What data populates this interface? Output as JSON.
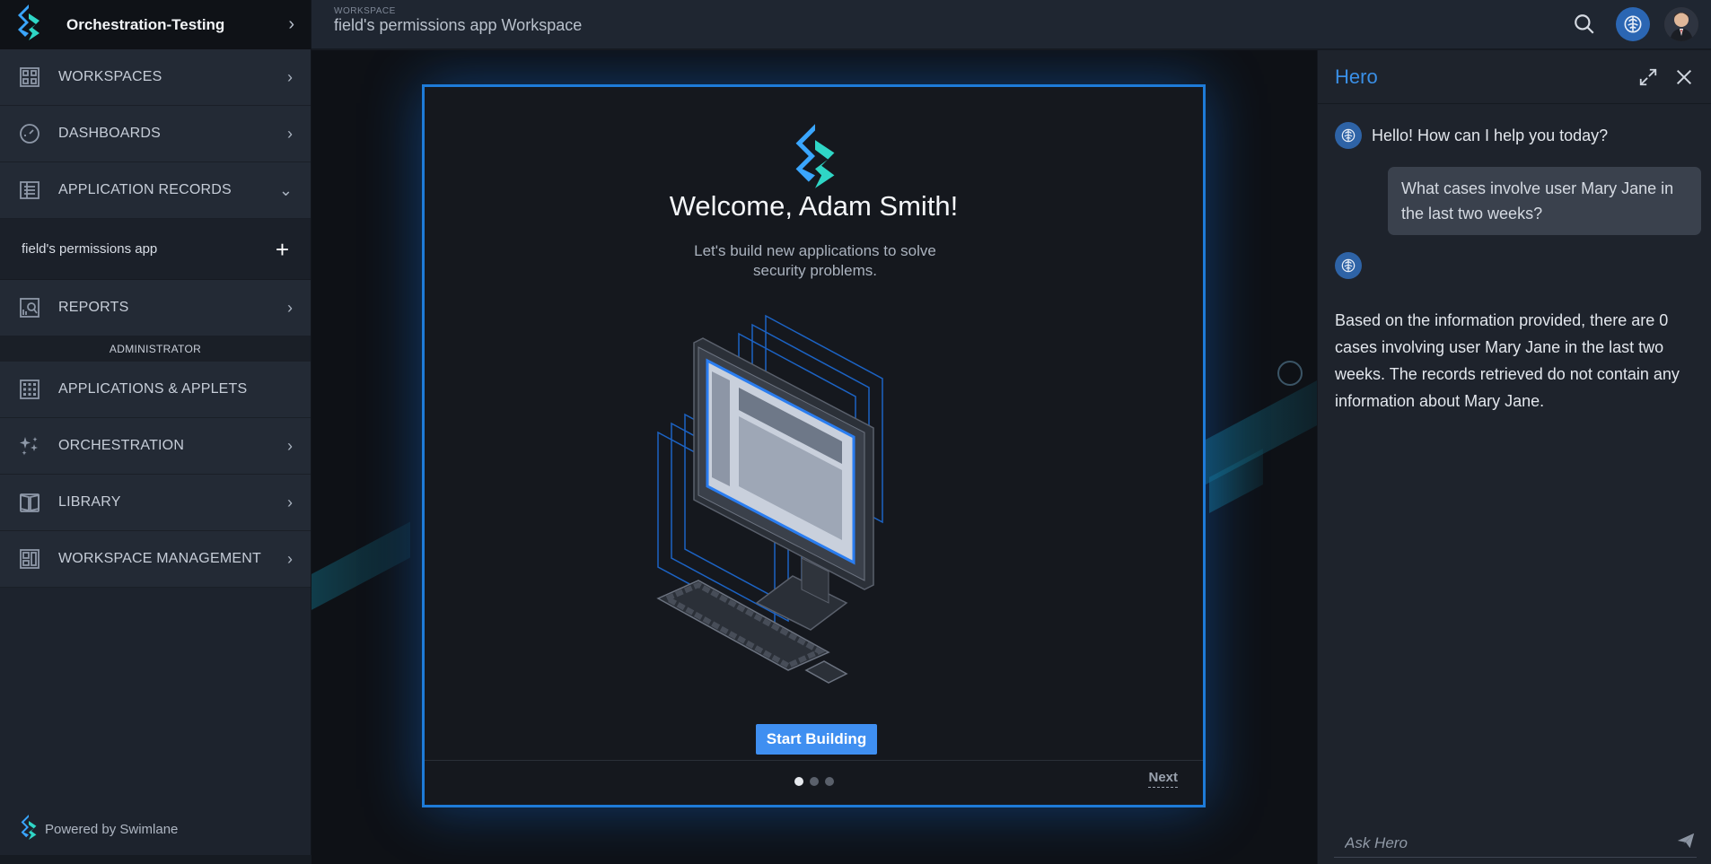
{
  "app": {
    "org_name": "Orchestration-Testing",
    "powered_by": "Powered by Swimlane"
  },
  "header": {
    "kicker": "WORKSPACE",
    "workspace_title": "field's permissions app Workspace",
    "icons": [
      "search-icon",
      "hero-ai-icon",
      "user-avatar"
    ]
  },
  "sidebar": {
    "items": [
      {
        "label": "WORKSPACES",
        "icon": "grid-icon"
      },
      {
        "label": "DASHBOARDS",
        "icon": "gauge-icon"
      },
      {
        "label": "APPLICATION RECORDS",
        "icon": "records-icon"
      },
      {
        "label": "REPORTS",
        "icon": "report-search-icon"
      },
      {
        "label": "APPLICATIONS & APPLETS",
        "icon": "apps-grid-icon"
      },
      {
        "label": "ORCHESTRATION",
        "icon": "sparkle-icon"
      },
      {
        "label": "LIBRARY",
        "icon": "book-icon"
      },
      {
        "label": "WORKSPACE MANAGEMENT",
        "icon": "layout-icon"
      }
    ],
    "sub_item": "field's permissions app",
    "admin_header": "ADMINISTRATOR"
  },
  "welcome_modal": {
    "title": "Welcome, Adam Smith!",
    "subtitle": "Let's build new applications to solve security problems.",
    "start_button": "Start Building",
    "next": "Next",
    "page_count": 3,
    "active_page": 1
  },
  "hero": {
    "title": "Hero",
    "greeting": "Hello! How can I help you today?",
    "user_question": "What cases involve user Mary Jane in the last two weeks?",
    "answer": "Based on the information provided, there are 0 cases involving user Mary Jane in the last two weeks. The records retrieved do not contain any information about Mary Jane.",
    "input_placeholder": "Ask Hero"
  },
  "colors": {
    "accent": "#3f8ff1",
    "hero_title": "#3a8fe6",
    "modal_border": "#1e7bd8"
  }
}
